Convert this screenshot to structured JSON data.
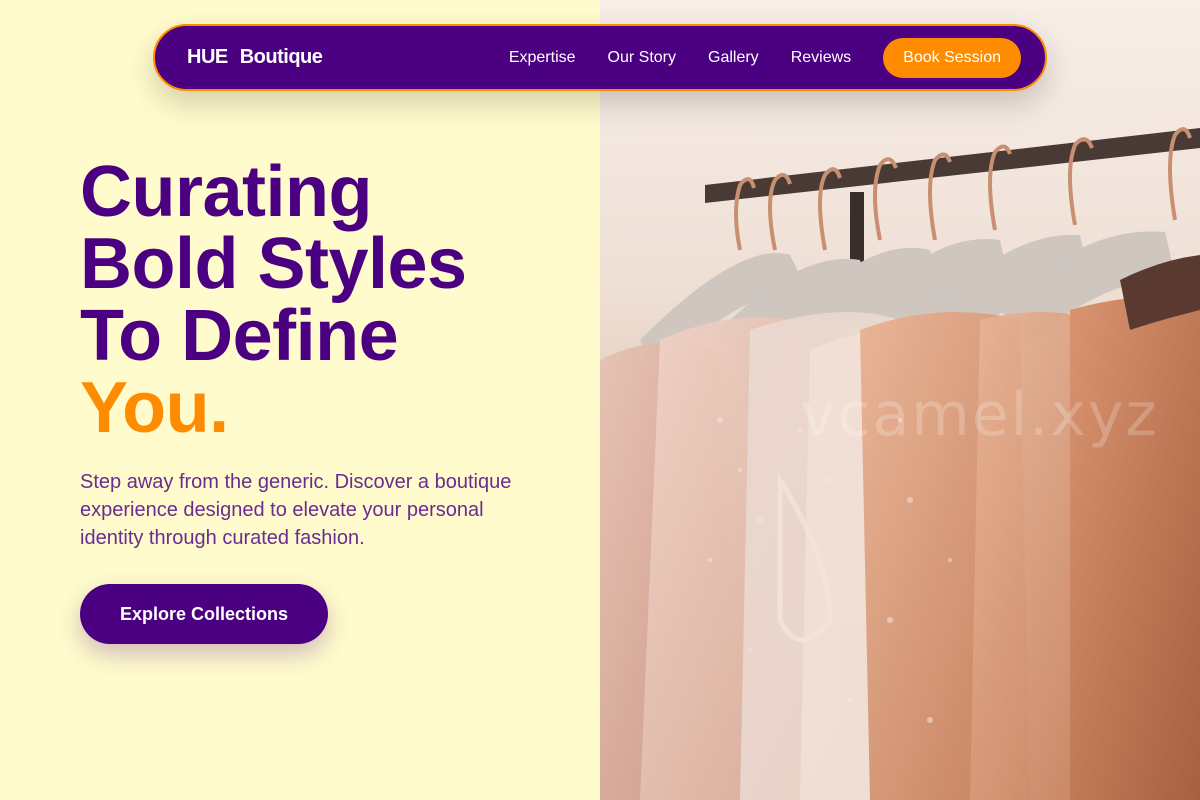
{
  "brand": {
    "part1": "HUE",
    "part2": "Boutique"
  },
  "nav": {
    "links": [
      "Expertise",
      "Our Story",
      "Gallery",
      "Reviews"
    ],
    "cta_label": "Book Session"
  },
  "hero": {
    "headline_lines": [
      "Curating",
      "Bold Styles",
      "To Define"
    ],
    "headline_accent": "You.",
    "subtext": "Step away from the generic. Discover a boutique experience designed to elevate your personal identity through curated fashion.",
    "cta_label": "Explore Collections",
    "image_alt": "clothing-rack"
  },
  "watermark": "vcamel.xyz",
  "colors": {
    "primary": "#4b0082",
    "accent": "#ff8c00",
    "background": "#fffbcc",
    "body_text": "#6a2c91"
  }
}
